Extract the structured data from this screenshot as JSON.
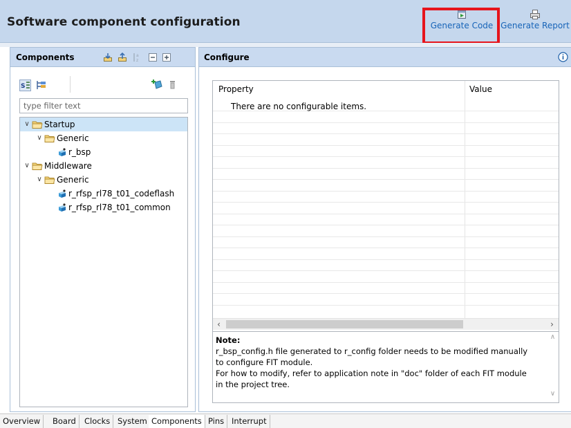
{
  "header": {
    "title": "Software component configuration",
    "generate_code_label": "Generate Code",
    "generate_report_label": "Generate Report",
    "highlight_color": "#e6141c"
  },
  "components_panel": {
    "title": "Components",
    "toolbar_icons": [
      "import-icon",
      "export-icon",
      "sort-icon",
      "collapse-all-icon",
      "expand-all-icon"
    ],
    "view_buttons": [
      "category-view-icon",
      "hierarchical-view-icon"
    ],
    "action_icons": [
      "add-component-icon",
      "remove-component-icon"
    ],
    "filter_placeholder": "type filter text",
    "tree": [
      {
        "label": "Startup",
        "level": 0,
        "type": "folder",
        "expanded": true,
        "selected": true
      },
      {
        "label": "Generic",
        "level": 1,
        "type": "folder",
        "expanded": true
      },
      {
        "label": "r_bsp",
        "level": 2,
        "type": "component"
      },
      {
        "label": "Middleware",
        "level": 0,
        "type": "folder",
        "expanded": true
      },
      {
        "label": "Generic",
        "level": 1,
        "type": "folder",
        "expanded": true
      },
      {
        "label": "r_rfsp_rl78_t01_codeflash",
        "level": 2,
        "type": "component"
      },
      {
        "label": "r_rfsp_rl78_t01_common",
        "level": 2,
        "type": "component"
      }
    ]
  },
  "configure_panel": {
    "title": "Configure",
    "info_icon": "info-icon",
    "columns": [
      "Property",
      "Value"
    ],
    "empty_message": "There are no configurable items.",
    "note": {
      "title": "Note:",
      "lines": [
        "r_bsp_config.h file generated to r_config folder needs to be modified manually",
        "to configure FIT module.",
        "For how to modify, refer to application note in \"doc\" folder of each FIT module",
        "in the project tree."
      ]
    }
  },
  "tabs": [
    {
      "label": "Overview",
      "active": false
    },
    {
      "label": "Board",
      "active": false
    },
    {
      "label": "Clocks",
      "active": false
    },
    {
      "label": "System",
      "active": false
    },
    {
      "label": "Components",
      "active": true
    },
    {
      "label": "Pins",
      "active": false
    },
    {
      "label": "Interrupt",
      "active": false
    }
  ]
}
